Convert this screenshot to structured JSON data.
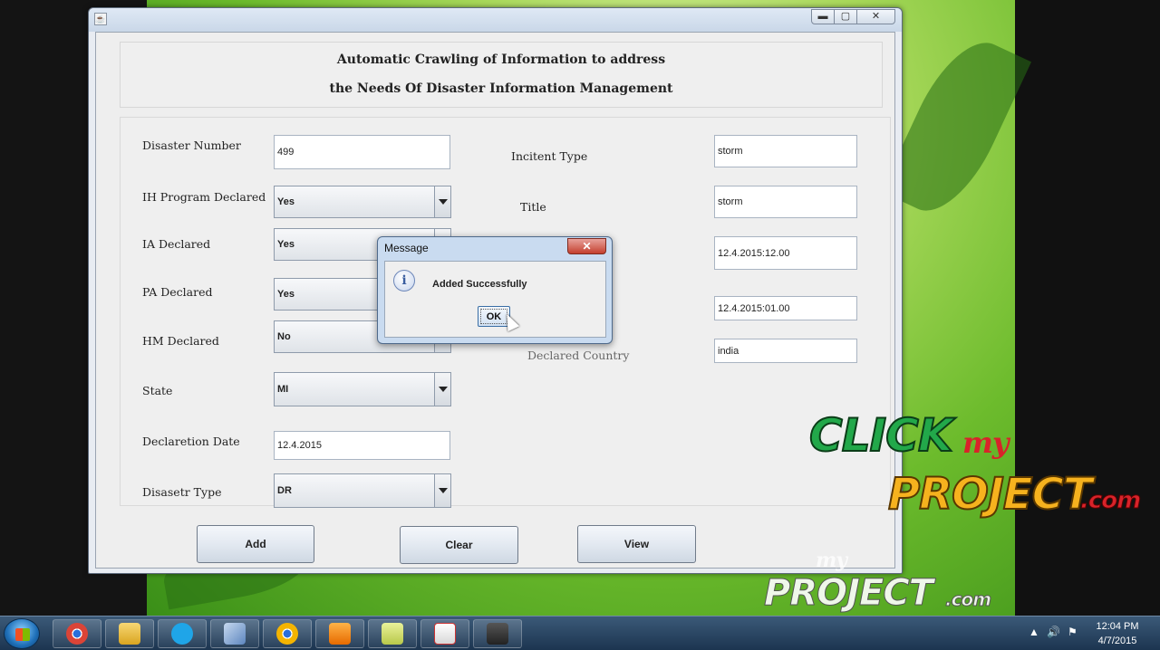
{
  "window": {
    "header_line1": "Automatic Crawling of Information to address",
    "header_line2": "the Needs Of Disaster Information Management",
    "controls": {
      "minimize": "▬",
      "maximize": "▢",
      "close": "✕"
    }
  },
  "form": {
    "disaster_number": {
      "label": "Disaster Number",
      "value": "499"
    },
    "ih_program_declared": {
      "label": "IH Program Declared",
      "value": "Yes"
    },
    "ia_declared": {
      "label": "IA Declared",
      "value": "Yes"
    },
    "pa_declared": {
      "label": "PA Declared",
      "value": "Yes"
    },
    "hm_declared": {
      "label": "HM Declared",
      "value": "No"
    },
    "state": {
      "label": "State",
      "value": "MI"
    },
    "declaration_date": {
      "label": "Declaretion Date",
      "value": "12.4.2015"
    },
    "disaster_type": {
      "label": "Disasetr Type",
      "value": "DR"
    },
    "incident_type": {
      "label": "Incitent Type",
      "value": "storm"
    },
    "title": {
      "label": "Title",
      "value": "storm"
    },
    "field_begin": {
      "value": "12.4.2015:12.00"
    },
    "field_end": {
      "value": "12.4.2015:01.00"
    },
    "declared_country": {
      "label": "Declared Country",
      "value": "india"
    }
  },
  "buttons": {
    "add": "Add",
    "clear": "Clear",
    "view": "View"
  },
  "dialog": {
    "title": "Message",
    "close": "✕",
    "icon_glyph": "i",
    "message": "Added Successfully",
    "ok": "OK"
  },
  "watermark": {
    "click": "CLICK",
    "my": "my",
    "project": "PROJECT",
    "com": ".com"
  },
  "taskbar": {
    "time": "12:04 PM",
    "date": "4/7/2015"
  },
  "colors": {
    "desktop_green": "#6cbb2c",
    "dialog_frame": "#c9dbf0",
    "close_red": "#c4402f",
    "watermark_green": "#22a84a",
    "watermark_orange": "#f6b21e"
  }
}
